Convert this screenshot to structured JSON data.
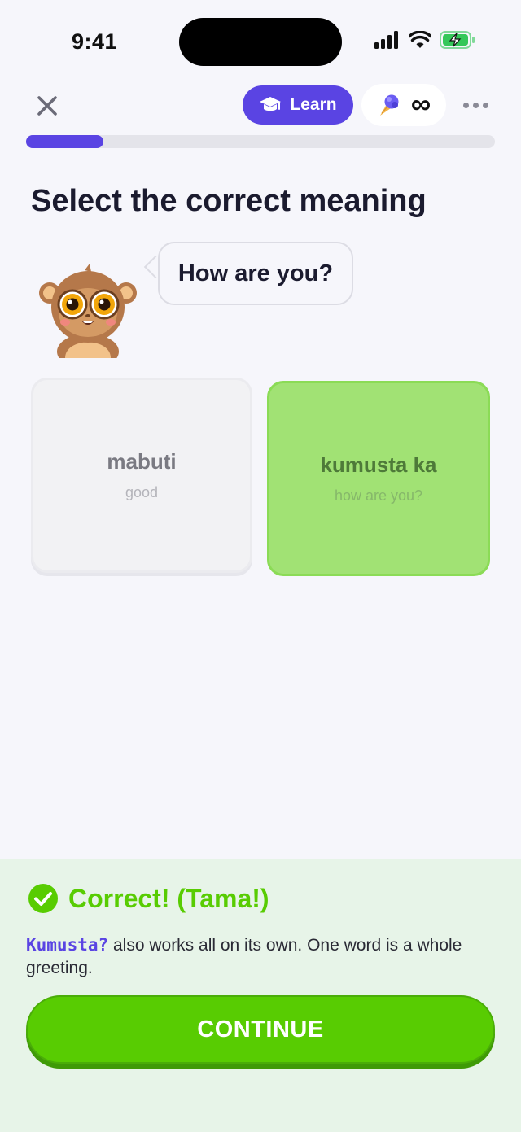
{
  "status_bar": {
    "time": "9:41",
    "icons": [
      "signal-icon",
      "wifi-icon",
      "battery-charging-icon"
    ]
  },
  "header": {
    "close_icon": "close-icon",
    "learn_label": "Learn",
    "learn_icon": "graduation-cap-icon",
    "lives_icon": "ice-cream-icon",
    "lives_value": "∞",
    "more_icon": "more-icon",
    "progress": 0.165
  },
  "question": {
    "prompt": "Select the correct meaning",
    "speech": "How are you?"
  },
  "options": [
    {
      "word": "mabuti",
      "translation": "good",
      "state": "unselected"
    },
    {
      "word": "kumusta ka",
      "translation": "how are you?",
      "state": "correct"
    }
  ],
  "feedback": {
    "title": "Correct! (Tama!)",
    "term": "Kumusta?",
    "explanation": " also works all on its own. One word is a whole greeting.",
    "button_label": "CONTINUE"
  },
  "colors": {
    "brand": "#5A44E3",
    "success": "#58CC02",
    "correct_card": "#A1E274",
    "feedback_bg": "#E7F4E8"
  }
}
